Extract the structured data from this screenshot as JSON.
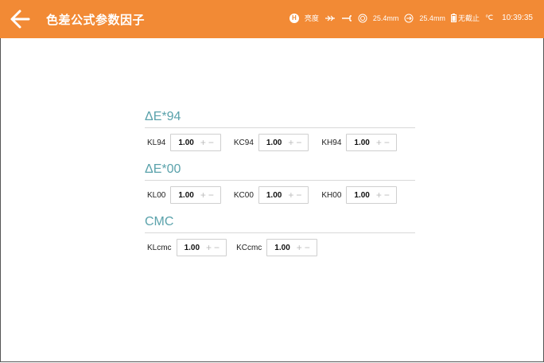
{
  "header": {
    "title": "色差公式参数因子",
    "status": {
      "mode_badge": "H",
      "mode_label": "亮度",
      "aperture_1": "25.4mm",
      "aperture_2": "25.4mm",
      "battery_label": "无截止",
      "temp_unit": "℃",
      "time": "10:39:35"
    }
  },
  "sections": [
    {
      "title": "ΔE*94",
      "params": [
        {
          "label": "KL94",
          "value": "1.00"
        },
        {
          "label": "KC94",
          "value": "1.00"
        },
        {
          "label": "KH94",
          "value": "1.00"
        }
      ]
    },
    {
      "title": "ΔE*00",
      "params": [
        {
          "label": "KL00",
          "value": "1.00"
        },
        {
          "label": "KC00",
          "value": "1.00"
        },
        {
          "label": "KH00",
          "value": "1.00"
        }
      ]
    },
    {
      "title": "CMC",
      "params": [
        {
          "label": "KLcmc",
          "value": "1.00"
        },
        {
          "label": "KCcmc",
          "value": "1.00"
        }
      ]
    }
  ],
  "stepper": {
    "plus": "+",
    "minus": "−"
  }
}
